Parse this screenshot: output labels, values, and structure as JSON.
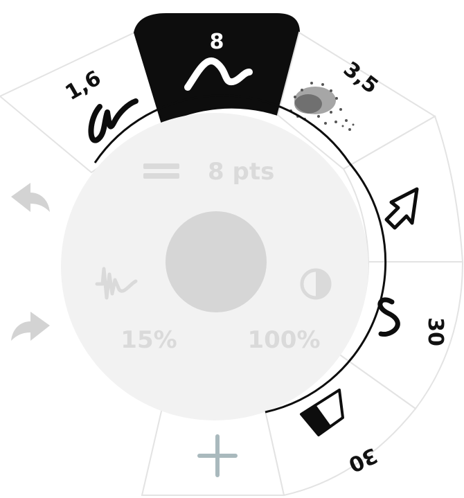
{
  "brush_wheel": {
    "segments": [
      {
        "id": "brush-pen",
        "label": "1,6",
        "icon": "pen-scribble-icon",
        "selected": false
      },
      {
        "id": "brush-wave",
        "label": "8",
        "icon": "wave-stroke-icon",
        "selected": true
      },
      {
        "id": "brush-spray",
        "label": "3,5",
        "icon": "spray-texture-icon",
        "selected": false
      },
      {
        "id": "tool-move",
        "label": "",
        "icon": "arrow-cursor-icon",
        "selected": false
      },
      {
        "id": "brush-smooth",
        "label": "30",
        "icon": "smooth-curve-icon",
        "selected": false
      },
      {
        "id": "brush-eraser",
        "label": "30",
        "icon": "eraser-icon",
        "selected": false
      },
      {
        "id": "add-brush",
        "label": "",
        "icon": "plus-icon",
        "selected": false
      }
    ]
  },
  "center_panel": {
    "size_label": "8 pts",
    "size_icon": "line-weight-icon",
    "smoothing_value": "15%",
    "smoothing_icon": "stabilizer-wave-icon",
    "opacity_value": "100%",
    "opacity_icon": "contrast-icon",
    "color_swatch": "#d6d6d6"
  },
  "history": {
    "undo_icon": "undo-arrow-icon",
    "redo_icon": "redo-arrow-icon"
  },
  "colors": {
    "selected_segment": "#0d0d0d",
    "segment_border": "#e3e3e3",
    "center_fill": "#f2f2f2",
    "disabled_text": "#dadada",
    "plus_accent": "#a9b9bd",
    "history_arrow": "#d3d3d3"
  }
}
